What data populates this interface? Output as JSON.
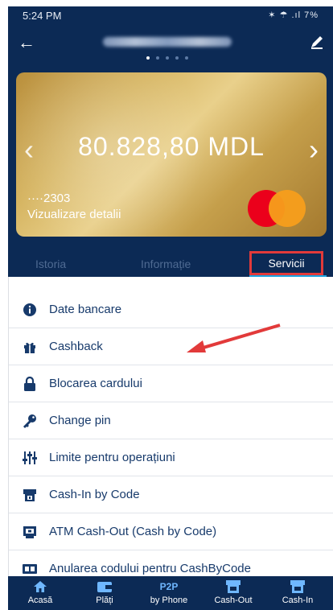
{
  "status_bar": {
    "time": "5:24 PM",
    "indicators": "✶ ☂ .ıl 7%"
  },
  "header": {
    "back_icon": "arrow-left-icon",
    "edit_icon": "pencil-icon"
  },
  "card": {
    "balance": "80.828,80 MDL",
    "number": "····2303",
    "details_link": "Vizualizare detalii",
    "brand_icon": "mastercard-logo",
    "colors": {
      "gold": "#d6b562",
      "mc_red": "#eb001b",
      "mc_orange": "#f79e1b"
    }
  },
  "tabs": [
    {
      "label": "Istoria",
      "active": false
    },
    {
      "label": "Informație",
      "active": false
    },
    {
      "label": "Servicii",
      "active": true
    }
  ],
  "services": [
    {
      "label": "Date bancare",
      "icon": "info-circle-icon"
    },
    {
      "label": "Cashback",
      "icon": "gift-icon"
    },
    {
      "label": "Blocarea cardului",
      "icon": "lock-icon"
    },
    {
      "label": "Change pin",
      "icon": "key-icon"
    },
    {
      "label": "Limite pentru operațiuni",
      "icon": "sliders-icon"
    },
    {
      "label": "Cash-In by Code",
      "icon": "cash-in-icon"
    },
    {
      "label": "ATM Cash-Out (Cash by Code)",
      "icon": "atm-icon"
    },
    {
      "label": "Anularea codului pentru CashByCode",
      "icon": "cancel-code-icon"
    }
  ],
  "bottom_nav": [
    {
      "label": "Acasă",
      "icon": "home-icon"
    },
    {
      "label": "Plăți",
      "icon": "wallet-icon"
    },
    {
      "top": "P2P",
      "label": "by Phone",
      "icon": "p2p-text"
    },
    {
      "label": "Cash-Out",
      "icon": "cash-out-icon"
    },
    {
      "label": "Cash-In",
      "icon": "cash-in-icon"
    }
  ],
  "colors": {
    "navy": "#0c2a55",
    "accent_blue": "#19a2e0",
    "highlight_red": "#e23a3a",
    "list_text": "#173a6b"
  }
}
